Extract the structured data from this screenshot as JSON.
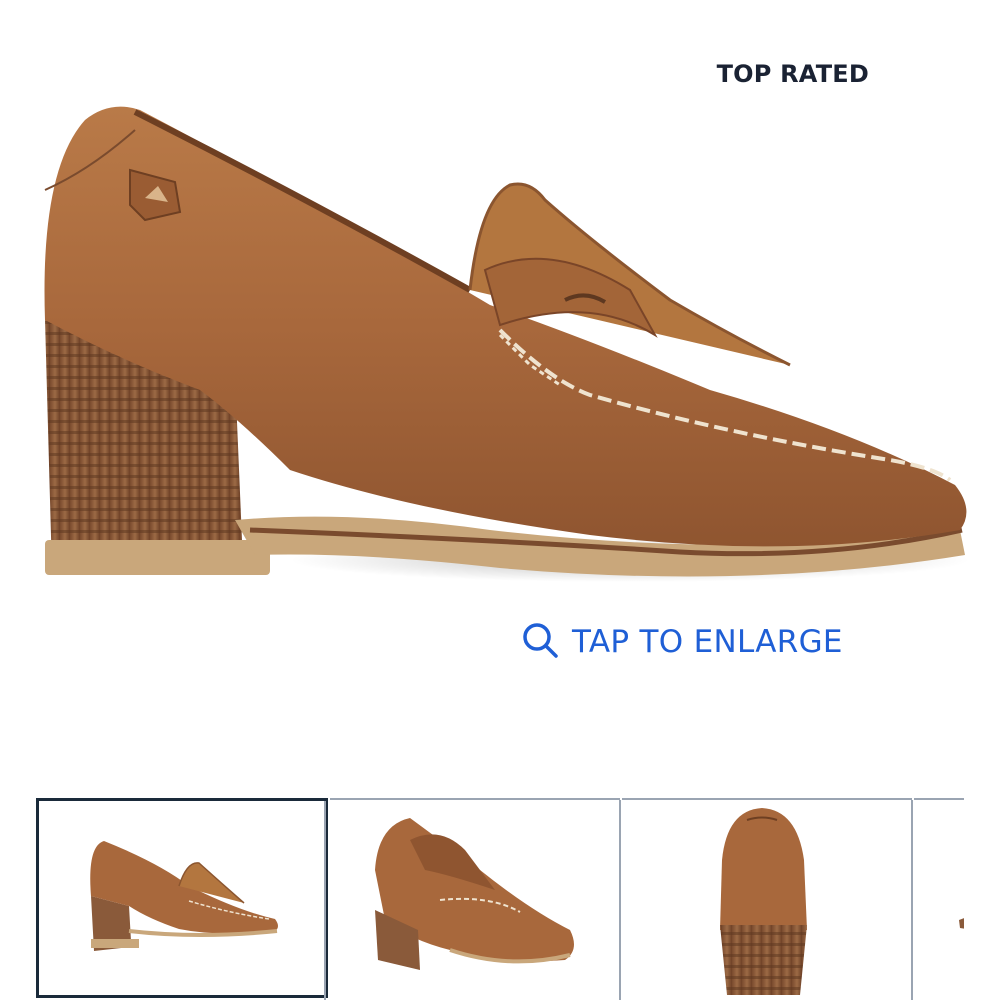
{
  "product": {
    "badge": "TOP RATED",
    "hero_image_alt": "Brown leather heeled penny loafer, side view"
  },
  "enlarge": {
    "icon": "search-icon",
    "label": "TAP TO ENLARGE",
    "color": "#1f5fd6"
  },
  "thumbnails": [
    {
      "view": "side",
      "selected": true
    },
    {
      "view": "angled-front",
      "selected": false
    },
    {
      "view": "back",
      "selected": false
    },
    {
      "view": "partial",
      "selected": false
    }
  ],
  "colors": {
    "leather": "#a8683c",
    "heel_stack": "#8a5a3a",
    "sole": "#c9a77b",
    "stitch": "#efe3cf",
    "badge_text": "#1a2233",
    "selected_border": "#1a2a3a"
  }
}
